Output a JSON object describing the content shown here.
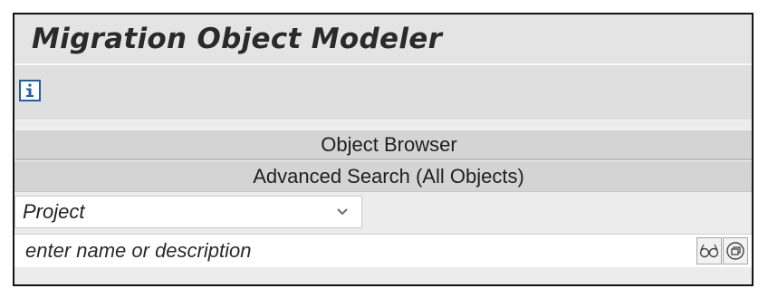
{
  "app": {
    "title": "Migration Object Modeler"
  },
  "toolbar": {
    "info_icon": "info-icon"
  },
  "sections": [
    {
      "label": "Object Browser"
    },
    {
      "label": "Advanced Search (All Objects)"
    }
  ],
  "search": {
    "scope_selected": "Project",
    "placeholder": "enter name or description",
    "value": "",
    "icons": [
      "glasses-search-icon",
      "popup-window-icon"
    ]
  },
  "colors": {
    "accent": "#1f5ea8",
    "frame_border": "#141414",
    "section_bg": "#d4d4d4"
  }
}
